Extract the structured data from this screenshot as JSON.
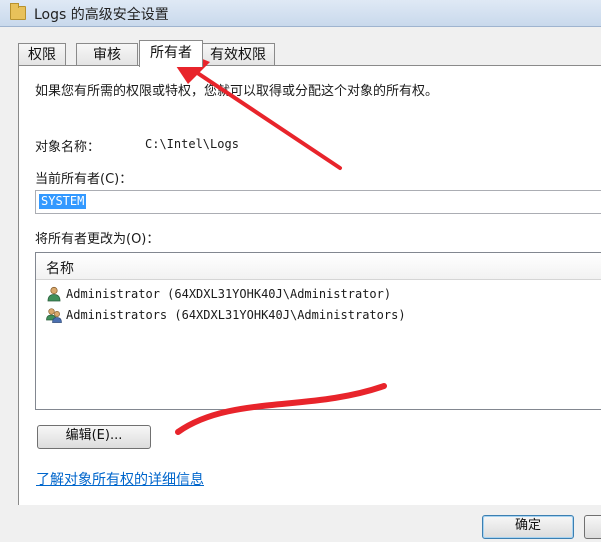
{
  "window": {
    "title": "Logs 的高级安全设置",
    "icon": "folder-icon"
  },
  "tabs": [
    {
      "label": "权限",
      "active": false
    },
    {
      "label": "审核",
      "active": false
    },
    {
      "label": "所有者",
      "active": true
    },
    {
      "label": "有效权限",
      "active": false
    }
  ],
  "owner_tab": {
    "intro": "如果您有所需的权限或特权，您就可以取得或分配这个对象的所有权。",
    "object_name_label": "对象名称：",
    "object_name_value": "C:\\Intel\\Logs",
    "current_owner_label": "当前所有者(C)：",
    "current_owner_value": "SYSTEM",
    "change_owner_label": "将所有者更改为(O)：",
    "list_header": "名称",
    "candidates": [
      {
        "name": "Administrator (64XDXL31YOHK40J\\Administrator)",
        "icon": "user-icon"
      },
      {
        "name": "Administrators (64XDXL31YOHK40J\\Administrators)",
        "icon": "group-icon"
      }
    ],
    "edit_button": "编辑(E)...",
    "learn_more_link": "了解对象所有权的详细信息"
  },
  "footer": {
    "ok_button": "确定"
  },
  "colors": {
    "selection": "#3399ff",
    "link": "#0066cc",
    "annotation": "#e8242b"
  }
}
